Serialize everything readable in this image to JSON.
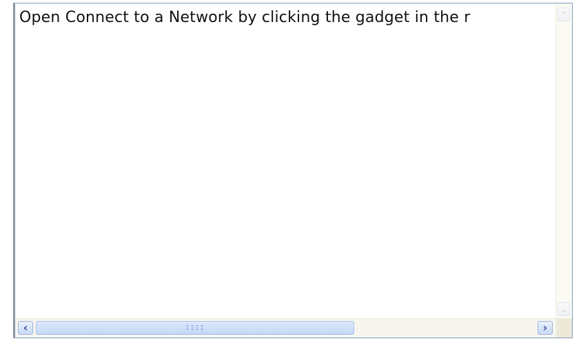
{
  "textarea": {
    "text": "Open Connect to a Network by clicking the gadget in the r"
  },
  "scrollbars": {
    "vertical": {
      "up_icon": "chevron-up-icon",
      "down_icon": "chevron-down-icon",
      "up_glyph": "⌃",
      "down_glyph": "⌄"
    },
    "horizontal": {
      "left_icon": "chevron-left-icon",
      "right_icon": "chevron-right-icon",
      "left_glyph": "‹",
      "right_glyph": "›",
      "grip_glyph": "IIII",
      "thumb_fraction": 0.6
    }
  },
  "colors": {
    "border": "#7f9db9",
    "scroll_button": "#c8d9f6",
    "scroll_track": "#f7f6ee"
  }
}
